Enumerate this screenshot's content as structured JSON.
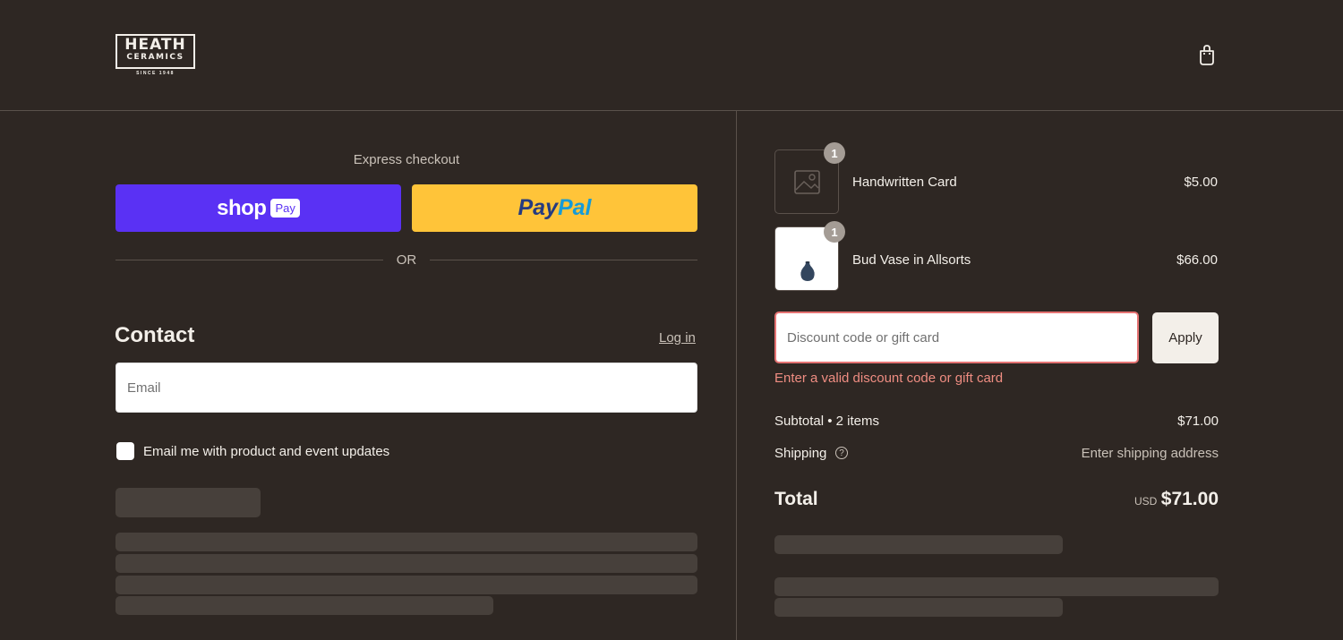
{
  "header": {
    "logo": {
      "line1": "HEATH",
      "line2": "CERAMICS",
      "tagline": "SINCE 1948"
    },
    "cart_icon": "shopping-bag-icon"
  },
  "express": {
    "label": "Express checkout",
    "shop_pay": {
      "word": "shop",
      "badge": "Pay",
      "color": "#5a31f4"
    },
    "paypal": {
      "part1": "Pay",
      "part2": "Pal",
      "color": "#ffc439"
    },
    "or_text": "OR"
  },
  "contact": {
    "title": "Contact",
    "login_label": "Log in",
    "email_placeholder": "Email",
    "email_value": "",
    "marketing_opt_in_label": "Email me with product and event updates",
    "marketing_opt_in_checked": false
  },
  "order": {
    "items": [
      {
        "name": "Handwritten Card",
        "price": "$5.00",
        "quantity": "1",
        "image_icon": "image-placeholder-icon"
      },
      {
        "name": "Bud Vase in Allsorts",
        "price": "$66.00",
        "quantity": "1",
        "image_icon": "vase-icon"
      }
    ],
    "discount": {
      "placeholder": "Discount code or gift card",
      "value": "",
      "apply_label": "Apply",
      "error": "Enter a valid discount code or gift card"
    },
    "subtotal_label": "Subtotal • 2 items",
    "subtotal_value": "$71.00",
    "shipping_label": "Shipping",
    "shipping_value": "Enter shipping address",
    "total_label": "Total",
    "total_currency": "USD",
    "total_value": "$71.00"
  },
  "colors": {
    "background": "#2e2723",
    "error": "#ef8d82",
    "skeleton": "#47403b"
  }
}
